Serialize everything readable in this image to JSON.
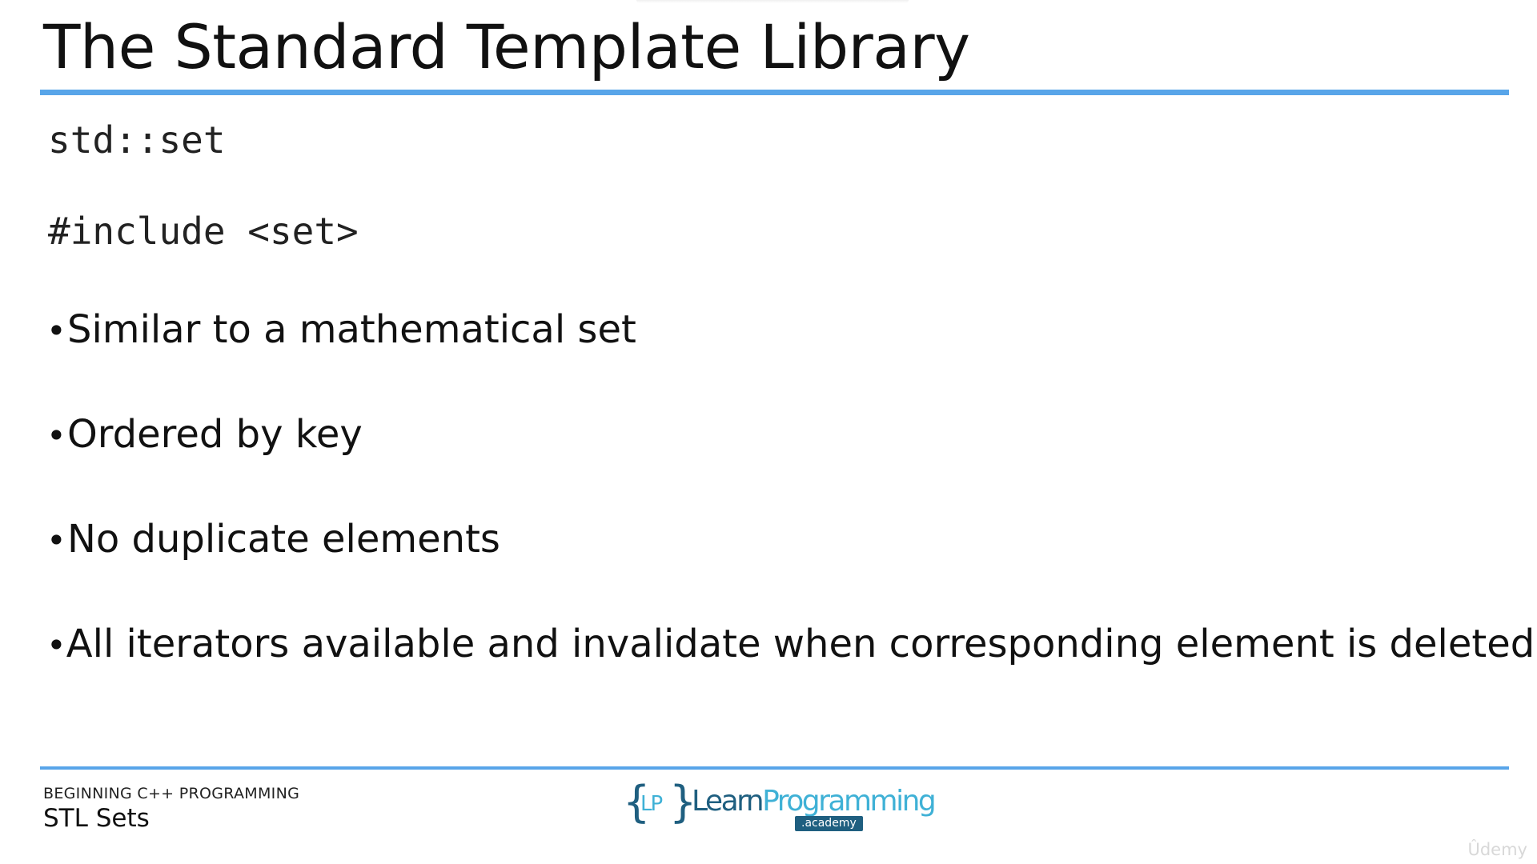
{
  "slide": {
    "title": "The Standard Template Library",
    "code_lines": [
      "std::set",
      "#include <set>"
    ],
    "bullets": [
      "Similar to a mathematical set",
      "Ordered by key",
      "No duplicate elements",
      "All iterators available and invalidate when corresponding element is deleted"
    ],
    "bullet_glyph": "•"
  },
  "footer": {
    "course": "BEGINNING C++ PROGRAMMING",
    "lecture": "STL Sets"
  },
  "logo": {
    "open_brace": "{",
    "initials": "LP",
    "close_brace": "}",
    "name_part1": "Learn",
    "name_part2": "Programming",
    "suffix": ".academy"
  },
  "watermark": "Ûdemy",
  "colors": {
    "accent_rule": "#58A5E9",
    "logo_dark": "#1F5F80",
    "logo_light": "#3FB1D6"
  }
}
